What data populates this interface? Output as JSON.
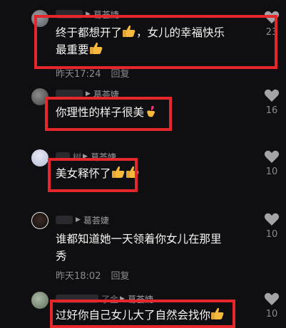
{
  "comments": [
    {
      "reply_to": "葛荟婕",
      "lines": [
        "终于都想开了",
        "，女儿的幸福快乐",
        "最重要"
      ],
      "time": "昨天17:24",
      "reply_label": "回复",
      "likes": "23",
      "icon": "thumbs-up-emoji"
    },
    {
      "reply_to": "葛荟婕",
      "lines": [
        "你理性的样子很美"
      ],
      "likes": "16",
      "icon": "finger-heart-emoji"
    },
    {
      "prefix": "树",
      "reply_to": "葛荟婕",
      "lines": [
        "美女释怀了"
      ],
      "likes": "10",
      "icon": "thumbs-up-emoji"
    },
    {
      "reply_to": "葛荟婕",
      "lines": [
        "谁都知道她一天领着你女儿在那里",
        "秀"
      ],
      "time": "昨天18:02",
      "reply_label": "回复",
      "likes": "10"
    },
    {
      "prefix": "了金",
      "reply_to": "葛荟婕",
      "lines": [
        "过好你自己女儿大了自然会找你"
      ],
      "likes": "10"
    }
  ],
  "colors": {
    "background": "#0f0f11",
    "highlight_box": "#e5262b",
    "muted_text": "#8b8b8f",
    "body_text": "#f4f4f4",
    "heart": "#a3a3a8"
  }
}
